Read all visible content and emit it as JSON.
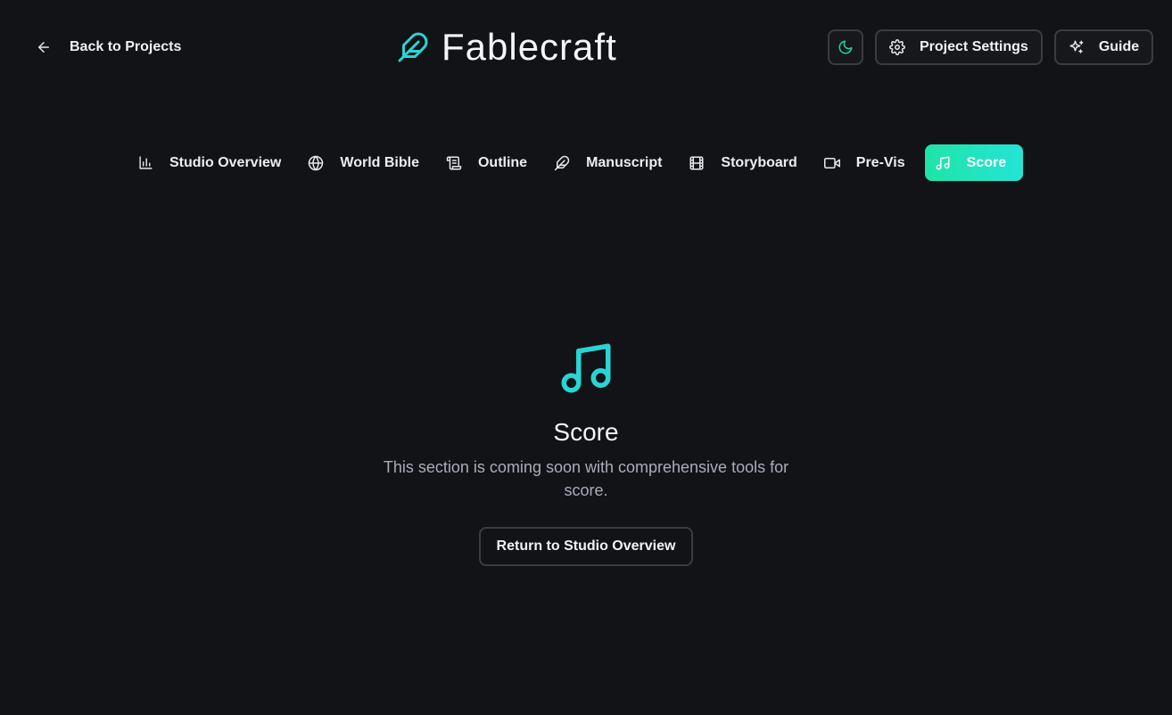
{
  "header": {
    "back_label": "Back to Projects",
    "brand_title": "Fablecraft",
    "theme_toggle_icon": "moon-icon",
    "settings_label": "Project Settings",
    "guide_label": "Guide"
  },
  "tabs": [
    {
      "label": "Studio Overview",
      "icon": "bar-chart-icon",
      "active": false
    },
    {
      "label": "World Bible",
      "icon": "globe-icon",
      "active": false
    },
    {
      "label": "Outline",
      "icon": "scroll-icon",
      "active": false
    },
    {
      "label": "Manuscript",
      "icon": "feather-icon",
      "active": false
    },
    {
      "label": "Storyboard",
      "icon": "film-icon",
      "active": false
    },
    {
      "label": "Pre-Vis",
      "icon": "video-icon",
      "active": false
    },
    {
      "label": "Score",
      "icon": "music-icon",
      "active": true
    }
  ],
  "main": {
    "icon": "music-icon",
    "title": "Score",
    "description": "This section is coming soon with comprehensive tools for score.",
    "return_label": "Return to Studio Overview"
  },
  "colors": {
    "background": "#121317",
    "accent_start": "#1fe4a7",
    "accent_end": "#24e4d6",
    "icon_teal": "#2ad4d4",
    "moon_green": "#22d39a",
    "muted_text": "#a9adb6",
    "border": "#3a3c42"
  }
}
